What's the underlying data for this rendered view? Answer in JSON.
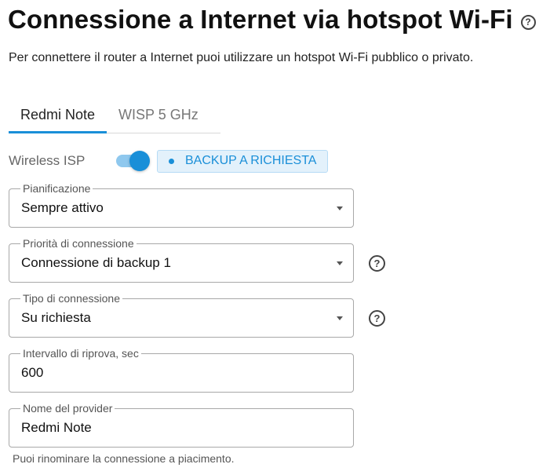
{
  "header": {
    "title": "Connessione a Internet via hotspot Wi-Fi",
    "help_icon": "question-circle",
    "subtitle": "Per connettere il router a Internet puoi utilizzare un hotspot Wi-Fi pubblico o privato."
  },
  "tabs": [
    {
      "label": "Redmi Note",
      "active": true
    },
    {
      "label": "WISP 5 GHz",
      "active": false
    }
  ],
  "wisp": {
    "label": "Wireless ISP",
    "toggle_on": true,
    "badge": "BACKUP A RICHIESTA"
  },
  "form": {
    "schedule": {
      "label": "Pianificazione",
      "value": "Sempre attivo"
    },
    "priority": {
      "label": "Priorità di connessione",
      "value": "Connessione di backup 1"
    },
    "connection_type": {
      "label": "Tipo di connessione",
      "value": "Su richiesta"
    },
    "retry_interval": {
      "label": "Intervallo di riprova, sec",
      "value": "600"
    },
    "provider_name": {
      "label": "Nome del provider",
      "value": "Redmi Note"
    },
    "provider_hint": "Puoi rinominare la connessione a piacimento."
  },
  "colors": {
    "accent": "#1a8fd8",
    "badge_bg": "#e3f1fb",
    "toggle_track": "#8fc8ee"
  }
}
